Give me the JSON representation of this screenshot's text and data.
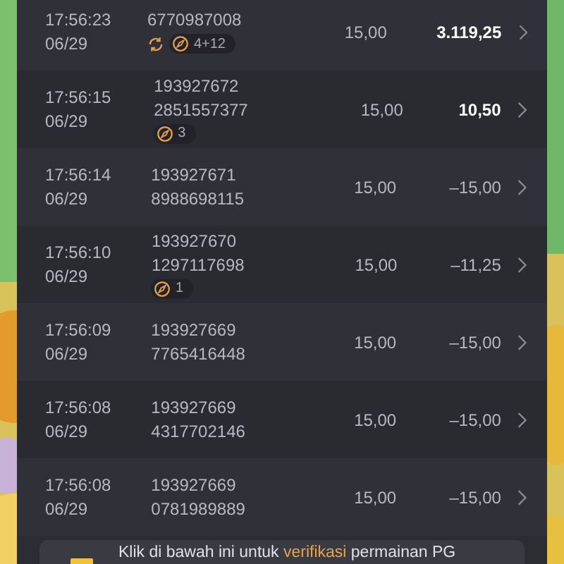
{
  "rows": [
    {
      "time": "17:56:23",
      "date": "06/29",
      "ids": [
        "6770987008"
      ],
      "bet": "15,00",
      "win": "3.119,25",
      "highlighted": true,
      "badges": [
        {
          "kind": "respin"
        },
        {
          "kind": "free",
          "count": "4+12"
        }
      ]
    },
    {
      "time": "17:56:15",
      "date": "06/29",
      "ids": [
        "193927672",
        "2851557377"
      ],
      "bet": "15,00",
      "win": "10,50",
      "highlighted": true,
      "badges": [
        {
          "kind": "free",
          "count": "3"
        }
      ]
    },
    {
      "time": "17:56:14",
      "date": "06/29",
      "ids": [
        "193927671",
        "8988698115"
      ],
      "bet": "15,00",
      "win": "–15,00",
      "highlighted": false,
      "badges": []
    },
    {
      "time": "17:56:10",
      "date": "06/29",
      "ids": [
        "193927670",
        "1297117698"
      ],
      "bet": "15,00",
      "win": "–11,25",
      "highlighted": false,
      "badges": [
        {
          "kind": "free",
          "count": "1"
        }
      ]
    },
    {
      "time": "17:56:09",
      "date": "06/29",
      "ids": [
        "193927669",
        "7765416448"
      ],
      "bet": "15,00",
      "win": "–15,00",
      "highlighted": false,
      "badges": []
    },
    {
      "time": "17:56:08",
      "date": "06/29",
      "ids": [
        "193927669",
        "4317702146"
      ],
      "bet": "15,00",
      "win": "–15,00",
      "highlighted": false,
      "badges": []
    },
    {
      "time": "17:56:08",
      "date": "06/29",
      "ids": [
        "193927669",
        "0781989889"
      ],
      "bet": "15,00",
      "win": "–15,00",
      "highlighted": false,
      "badges": []
    }
  ],
  "notice": {
    "parts": [
      {
        "kind": "plain",
        "text": "Klik di bawah ini untuk "
      },
      {
        "kind": "link",
        "text": "verifikasi"
      },
      {
        "kind": "plain",
        "text": " permainan PG"
      }
    ]
  }
}
